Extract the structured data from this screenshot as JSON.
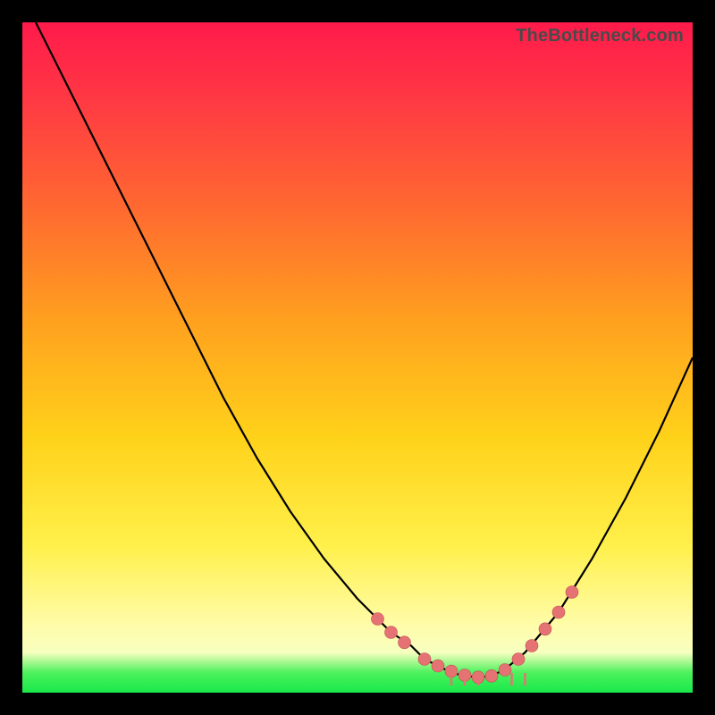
{
  "watermark": "TheBottleneck.com",
  "colors": {
    "background": "#000000",
    "gradient_top": "#ff1a4b",
    "gradient_mid": "#ffd21a",
    "gradient_bottom": "#18e84a",
    "curve": "#000000",
    "marker": "#e57373"
  },
  "chart_data": {
    "type": "line",
    "title": "",
    "xlabel": "",
    "ylabel": "",
    "xlim": [
      0,
      100
    ],
    "ylim": [
      0,
      100
    ],
    "grid": false,
    "legend": false,
    "series": [
      {
        "name": "curve",
        "x": [
          2,
          5,
          10,
          15,
          20,
          25,
          30,
          35,
          40,
          45,
          50,
          55,
          58,
          60,
          62,
          64,
          66,
          68,
          70,
          72,
          75,
          80,
          85,
          90,
          95,
          100
        ],
        "y": [
          100,
          94,
          84,
          74,
          64,
          54,
          44,
          35,
          27,
          20,
          14,
          9,
          7,
          5,
          4,
          3,
          2.5,
          2.3,
          2.5,
          3.5,
          6,
          12,
          20,
          29,
          39,
          50
        ]
      }
    ],
    "markers": {
      "name": "highlight-points",
      "x": [
        53,
        55,
        57,
        60,
        62,
        64,
        66,
        68,
        70,
        72,
        74,
        76,
        78,
        80,
        82
      ],
      "y": [
        11,
        9,
        7.5,
        5,
        4,
        3.2,
        2.6,
        2.3,
        2.5,
        3.4,
        5,
        7,
        9.5,
        12,
        15
      ]
    },
    "bottom_ticks_x": [
      64,
      66,
      68,
      73,
      75
    ]
  }
}
